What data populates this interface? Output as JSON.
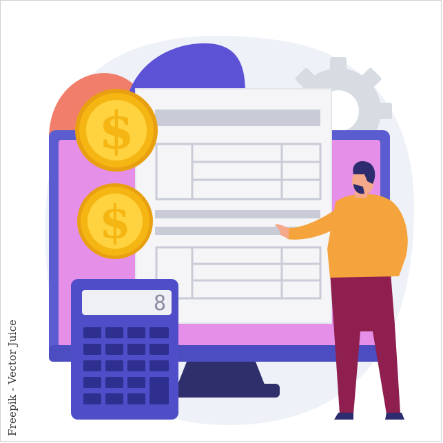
{
  "attribution": {
    "text": "Freepik - Vector Juice"
  },
  "calculator": {
    "display_value": "8"
  },
  "icons": {
    "coin_symbol": "$",
    "coin_top": "dollar-coin-icon",
    "coin_bottom": "dollar-coin-icon",
    "gear": "gear-icon"
  },
  "colors": {
    "background_blob": "#eef1f7",
    "blue_blob": "#5b52d6",
    "coral_blob": "#f07e6a",
    "gear": "#d7dbe2",
    "monitor_frame": "#5a5ccf",
    "monitor_screen": "#e58fe8",
    "monitor_stand": "#2e2f6b",
    "document": "#f5f5f7",
    "form_lines": "#c9ccd6",
    "coin_gold": "#f5b614",
    "coin_light": "#ffd23f",
    "calculator_body": "#4f4dc8",
    "calculator_display": "#eef0f6",
    "shirt": "#f5a33c",
    "pants": "#8e1f4f",
    "hair": "#2c2c6e",
    "skin": "#f6a88a"
  }
}
